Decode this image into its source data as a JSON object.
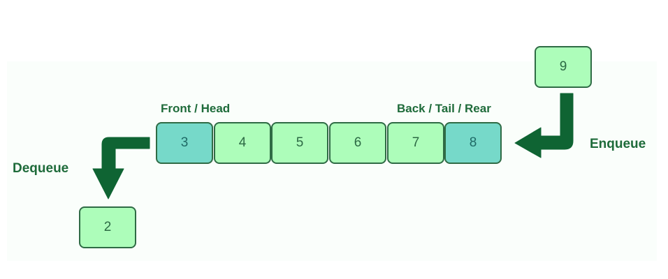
{
  "queue": {
    "cells": [
      {
        "value": "3",
        "role": "front"
      },
      {
        "value": "4",
        "role": "middle"
      },
      {
        "value": "5",
        "role": "middle"
      },
      {
        "value": "6",
        "role": "middle"
      },
      {
        "value": "7",
        "role": "middle"
      },
      {
        "value": "8",
        "role": "rear"
      }
    ],
    "front_label": "Front / Head",
    "rear_label": "Back / Tail / Rear"
  },
  "enqueue": {
    "label": "Enqueue",
    "value": "9"
  },
  "dequeue": {
    "label": "Dequeue",
    "value": "2"
  },
  "colors": {
    "cell_fill": "#adfdba",
    "end_cell_fill": "#76d9c9",
    "border": "#2f6b45",
    "arrow": "#0f6433",
    "label_text": "#1e6b3a"
  }
}
